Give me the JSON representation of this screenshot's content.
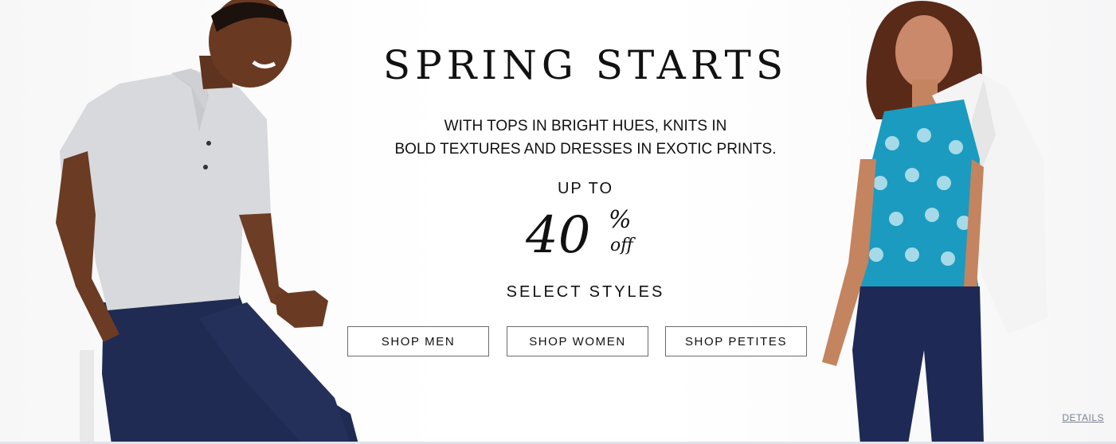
{
  "promo": {
    "headline": "SPRING STARTS",
    "subcopy_line1": "WITH TOPS IN BRIGHT HUES, KNITS IN",
    "subcopy_line2": "BOLD TEXTURES AND DRESSES IN EXOTIC PRINTS.",
    "up_to": "UP TO",
    "discount_value": "40",
    "discount_percent": "%",
    "discount_off": "off",
    "select_styles": "SELECT STYLES"
  },
  "buttons": {
    "shop_men": "SHOP MEN",
    "shop_women": "SHOP WOMEN",
    "shop_petites": "SHOP PETITES"
  },
  "details_link": "DETAILS",
  "colors": {
    "text": "#111111",
    "button_border": "#6b6b6b",
    "details_link": "#7a8190",
    "pants_navy": "#1e2a55",
    "top_teal": "#1b9bbf",
    "polo_grey": "#d9dadc"
  }
}
